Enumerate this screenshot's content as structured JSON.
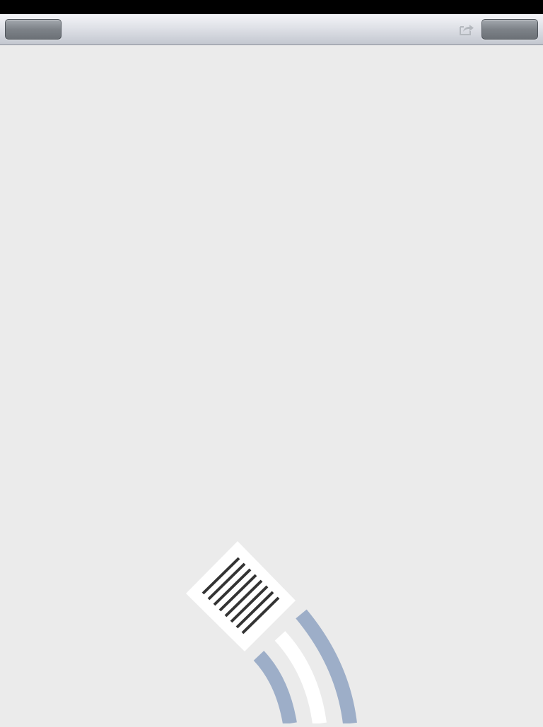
{
  "status_bar": {},
  "toolbar": {
    "left_button_label": "",
    "right_button_label": "",
    "share_icon": "share-icon"
  },
  "placeholder": {
    "icon": "document-transmission-icon",
    "colors": {
      "document": "#ffffff",
      "lines": "#333333",
      "waves": "#9daec8",
      "background": "#ebebeb"
    }
  }
}
